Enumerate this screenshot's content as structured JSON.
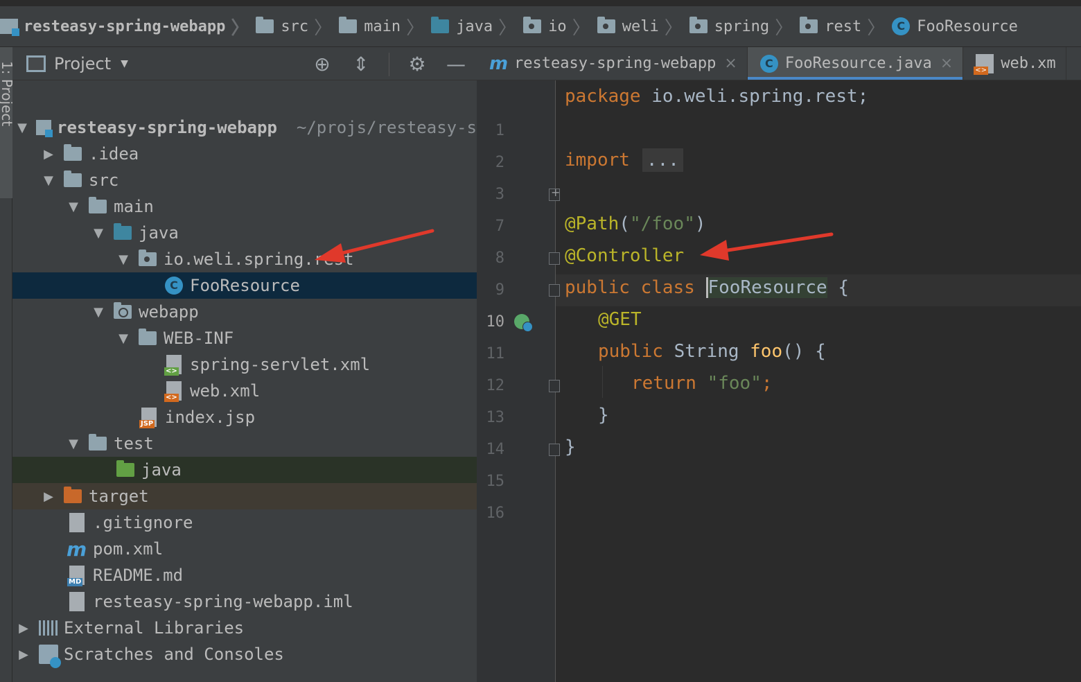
{
  "breadcrumb": {
    "project": "resteasy-spring-webapp",
    "items": [
      "src",
      "main",
      "java",
      "io",
      "weli",
      "spring",
      "rest"
    ],
    "class": "FooResource"
  },
  "tool_stripe": {
    "label": "1: Project"
  },
  "project_panel": {
    "title": "Project",
    "tools": [
      "locate-icon",
      "collapse-all-icon",
      "gear-icon",
      "minimize-icon"
    ],
    "tree": [
      {
        "label": "resteasy-spring-webapp",
        "hint": "~/projs/resteasy-s",
        "expanded": true
      },
      {
        "label": ".idea",
        "expanded": false
      },
      {
        "label": "src",
        "expanded": true
      },
      {
        "label": "main",
        "expanded": true
      },
      {
        "label": "java",
        "expanded": true
      },
      {
        "label": "io.weli.spring.rest",
        "expanded": true
      },
      {
        "label": "FooResource",
        "selected": true
      },
      {
        "label": "webapp",
        "expanded": true
      },
      {
        "label": "WEB-INF",
        "expanded": true
      },
      {
        "label": "spring-servlet.xml"
      },
      {
        "label": "web.xml"
      },
      {
        "label": "index.jsp",
        "badge": "JSP"
      },
      {
        "label": "test",
        "expanded": true
      },
      {
        "label": "java"
      },
      {
        "label": "target",
        "expanded": false
      },
      {
        "label": ".gitignore"
      },
      {
        "label": "pom.xml"
      },
      {
        "label": "README.md",
        "badge": "MD"
      },
      {
        "label": "resteasy-spring-webapp.iml"
      },
      {
        "label": "External Libraries",
        "expanded": false
      },
      {
        "label": "Scratches and Consoles",
        "expanded": false
      }
    ]
  },
  "editor": {
    "tabs": [
      {
        "label": "resteasy-spring-webapp",
        "close": "×"
      },
      {
        "label": "FooResource.java",
        "close": "×",
        "active": true
      },
      {
        "label": "web.xm"
      }
    ],
    "line_numbers": [
      "1",
      "2",
      "3",
      "7",
      "8",
      "9",
      "10",
      "11",
      "12",
      "13",
      "14",
      "15",
      "16"
    ],
    "code": {
      "l1_kw": "package",
      "l1_rest": " io.weli.spring.rest;",
      "l3_kw": "import",
      "l3_folded": "...",
      "l8_ann": "@Path",
      "l8_open": "(",
      "l8_str": "\"/foo\"",
      "l8_close": ")",
      "l9_ann": "@Controller",
      "l10_kw": "public class ",
      "l10_cls": "FooResource",
      "l10_rest": " {",
      "l11_ann": "@GET",
      "l12_kw": "public ",
      "l12_type": "String ",
      "l12_fn": "foo",
      "l12_rest": "() {",
      "l13_kw": "return ",
      "l13_str": "\"foo\"",
      "l13_semi": ";",
      "l14": "}",
      "l15": "}"
    }
  },
  "colors": {
    "arrow": "#e0392b",
    "keyword": "#cc7832",
    "annotation": "#bbb529",
    "string": "#6a8759",
    "selection": "#0d293e"
  }
}
